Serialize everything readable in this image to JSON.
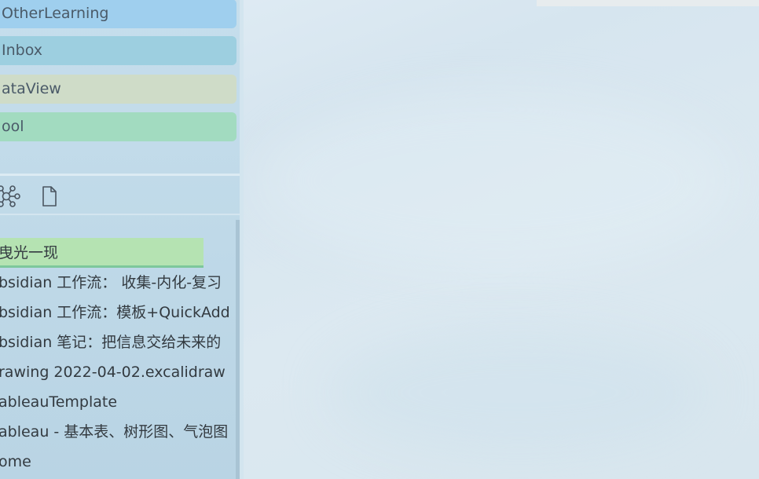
{
  "folders": [
    {
      "label": "OtherLearning",
      "color": "#9fcfee"
    },
    {
      "label": "Inbox",
      "color": "#9dcfe0"
    },
    {
      "label": "ataView",
      "color": "#cfdcc8"
    },
    {
      "label": "ool",
      "color": "#a2dbc0"
    }
  ],
  "toolbar": {
    "graph_icon": "graph-view-icon",
    "file_icon": "new-file-icon"
  },
  "files": [
    {
      "label": "曳光一现",
      "active": true
    },
    {
      "label": "bsidian 工作流： 收集-内化-复习"
    },
    {
      "label": "bsidian 工作流：模板+QuickAdd"
    },
    {
      "label": "bsidian 笔记：把信息交给未来的"
    },
    {
      "label": "rawing 2022-04-02.excalidraw"
    },
    {
      "label": "ableauTemplate"
    },
    {
      "label": "ableau - 基本表、树形图、气泡图"
    },
    {
      "label": "ome"
    }
  ]
}
